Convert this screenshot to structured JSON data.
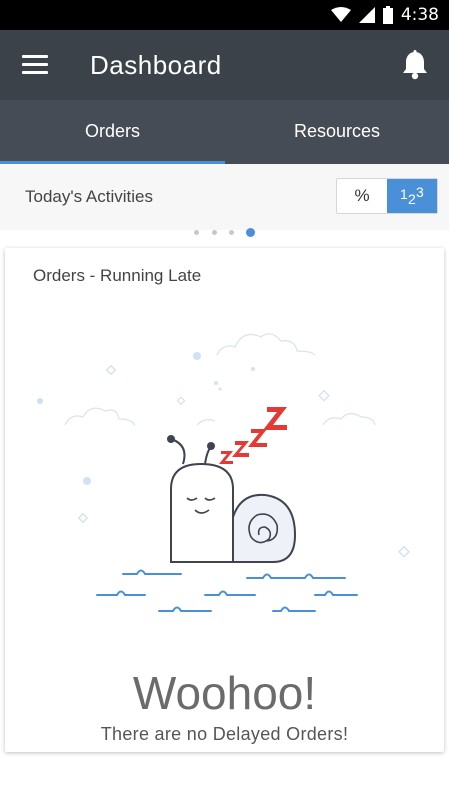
{
  "status_bar": {
    "time": "4:38",
    "icons": [
      "wifi-icon",
      "signal-icon",
      "battery-icon"
    ]
  },
  "app_bar": {
    "title": "Dashboard",
    "menu_icon": "menu-icon",
    "notification_icon": "bell-icon"
  },
  "tabs": [
    {
      "label": "Orders",
      "active": true
    },
    {
      "label": "Resources",
      "active": false
    }
  ],
  "activities": {
    "title": "Today's Activities",
    "toggle": {
      "percent_label": "%",
      "count_label": "1 2 3",
      "selected": "count"
    }
  },
  "pager": {
    "count": 4,
    "active_index": 3
  },
  "card": {
    "title": "Orders - Running Late",
    "illustration": "sleeping-snail",
    "sleep_text": "ZZZZ",
    "headline": "Woohoo!",
    "message": "There are no Delayed Orders!"
  },
  "colors": {
    "app_bar": "#3c424a",
    "tab_bar": "#464c55",
    "accent": "#4a90d9",
    "zzz": "#e53935"
  }
}
